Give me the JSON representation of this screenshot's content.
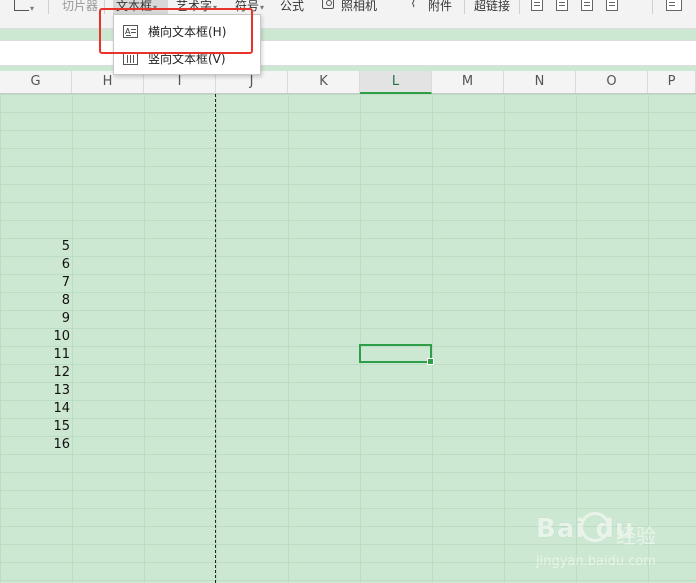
{
  "ribbon": {
    "slicer": "切片器",
    "textbox": "文本框",
    "wordart": "艺术字",
    "symbol": "符号",
    "formula": "公式",
    "camera": "照相机",
    "attachment": "附件",
    "hyperlink": "超链接",
    "caret": "▾"
  },
  "dropdown": {
    "items": [
      {
        "label": "横向文本框(H)",
        "icon": "horizontal-textbox-icon"
      },
      {
        "label": "竖向文本框(V)",
        "icon": "vertical-textbox-icon"
      }
    ]
  },
  "columns": [
    "G",
    "H",
    "I",
    "J",
    "K",
    "L",
    "M",
    "N",
    "O",
    "P"
  ],
  "active_column": "L",
  "cell_values": [
    "5",
    "6",
    "7",
    "8",
    "9",
    "10",
    "11",
    "12",
    "13",
    "14",
    "15",
    "16"
  ],
  "watermark": {
    "logo": "Bai  du",
    "cn": "经验",
    "url": "jingyan.baidu.com"
  },
  "colors": {
    "cell_background": "#cde8d2",
    "selection": "#2e9e48",
    "highlight": "#e8322a"
  }
}
